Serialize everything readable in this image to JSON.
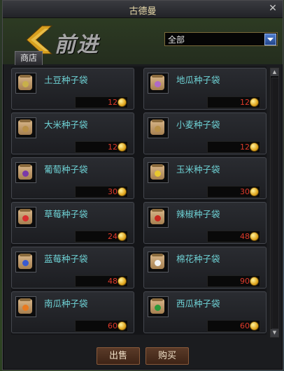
{
  "window": {
    "title": "古德曼"
  },
  "header": {
    "forward_text": "前进",
    "shop_tab": "商店"
  },
  "filter": {
    "selected": "全部"
  },
  "items": [
    {
      "name": "土豆种子袋",
      "price": "12",
      "seed_color": "#c8b04a",
      "icon": "potato-seed-bag-icon"
    },
    {
      "name": "地瓜种子袋",
      "price": "12",
      "seed_color": "#b06ac8",
      "icon": "sweet-potato-seed-bag-icon"
    },
    {
      "name": "大米种子袋",
      "price": "12",
      "seed_color": "#b89048",
      "icon": "rice-seed-bag-icon"
    },
    {
      "name": "小麦种子袋",
      "price": "12",
      "seed_color": "#b89048",
      "icon": "wheat-seed-bag-icon"
    },
    {
      "name": "葡萄种子袋",
      "price": "30",
      "seed_color": "#7a3aa8",
      "icon": "grape-seed-bag-icon"
    },
    {
      "name": "玉米种子袋",
      "price": "30",
      "seed_color": "#e8c830",
      "icon": "corn-seed-bag-icon"
    },
    {
      "name": "草莓种子袋",
      "price": "24",
      "seed_color": "#d83030",
      "icon": "strawberry-seed-bag-icon"
    },
    {
      "name": "辣椒种子袋",
      "price": "48",
      "seed_color": "#c82a20",
      "icon": "chili-seed-bag-icon"
    },
    {
      "name": "蓝莓种子袋",
      "price": "48",
      "seed_color": "#3a5ad0",
      "icon": "blueberry-seed-bag-icon"
    },
    {
      "name": "棉花种子袋",
      "price": "90",
      "seed_color": "#f2f2f2",
      "icon": "cotton-seed-bag-icon"
    },
    {
      "name": "南瓜种子袋",
      "price": "60",
      "seed_color": "#e87a20",
      "icon": "pumpkin-seed-bag-icon"
    },
    {
      "name": "西瓜种子袋",
      "price": "60",
      "seed_color": "#2a9a3a",
      "icon": "watermelon-seed-bag-icon"
    }
  ],
  "footer": {
    "sell_label": "出售",
    "buy_label": "购买"
  }
}
